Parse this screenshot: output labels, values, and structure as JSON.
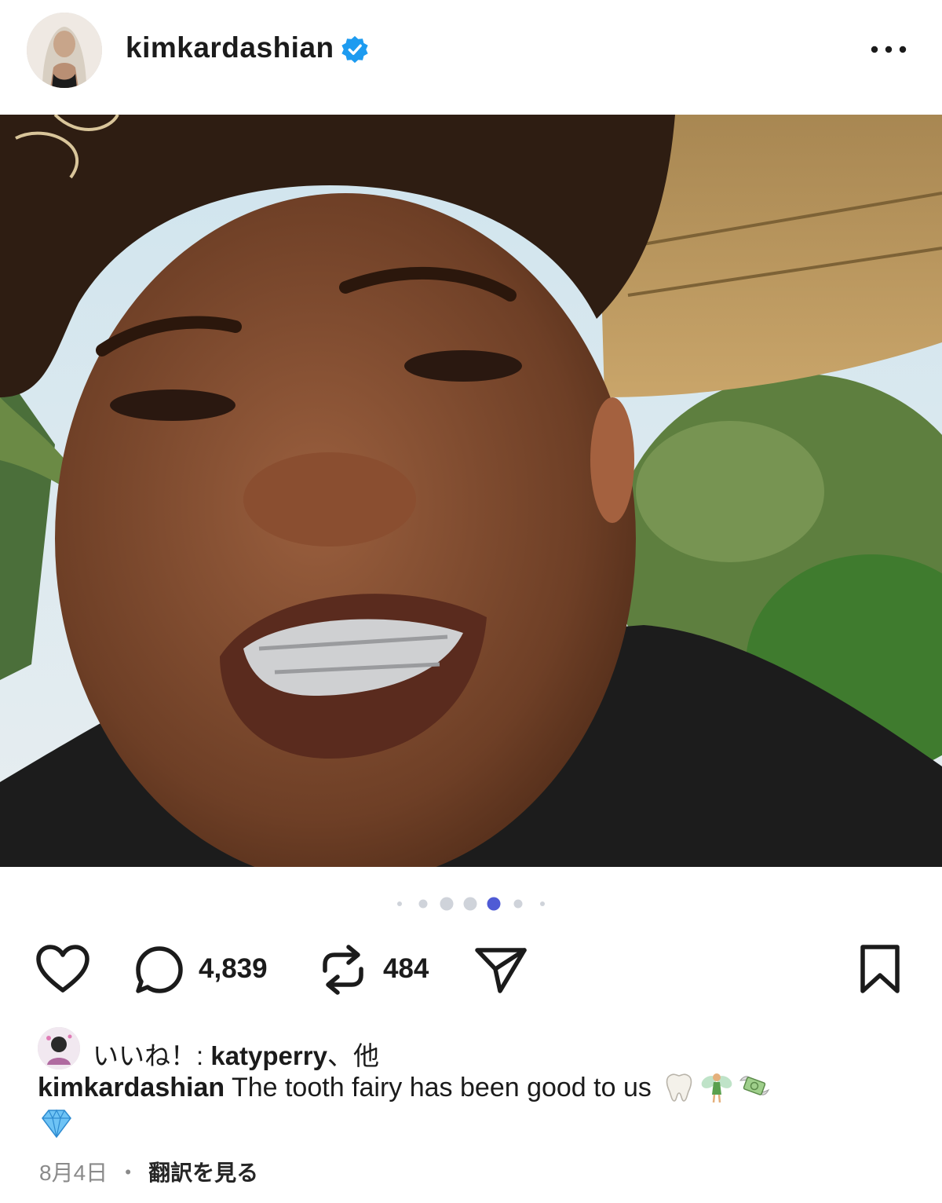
{
  "post": {
    "username": "kimkardashian",
    "verified": true,
    "more_icon": "more-horizontal-icon"
  },
  "photo": {
    "carousel_total": 7,
    "carousel_active_index": 4
  },
  "actions": {
    "like_icon": "heart-icon",
    "comment_icon": "comment-icon",
    "comment_count": "4,839",
    "repost_icon": "repost-icon",
    "repost_count": "484",
    "share_icon": "send-icon",
    "save_icon": "bookmark-icon"
  },
  "likes": {
    "prefix": "いいね！: ",
    "liker": "katyperry",
    "suffix": "、他"
  },
  "caption": {
    "username": "kimkardashian",
    "text": " The tooth fairy has been good to us ",
    "emojis": [
      "tooth-emoji",
      "fairy-emoji",
      "money-wings-emoji",
      "gem-emoji"
    ]
  },
  "meta": {
    "date": "8月4日",
    "separator": "・",
    "translate_label": "翻訳を見る"
  },
  "colors": {
    "verified_blue": "#1d9bf0",
    "active_dot": "#4f5bd5",
    "icon_dark": "#1b1b1b"
  }
}
